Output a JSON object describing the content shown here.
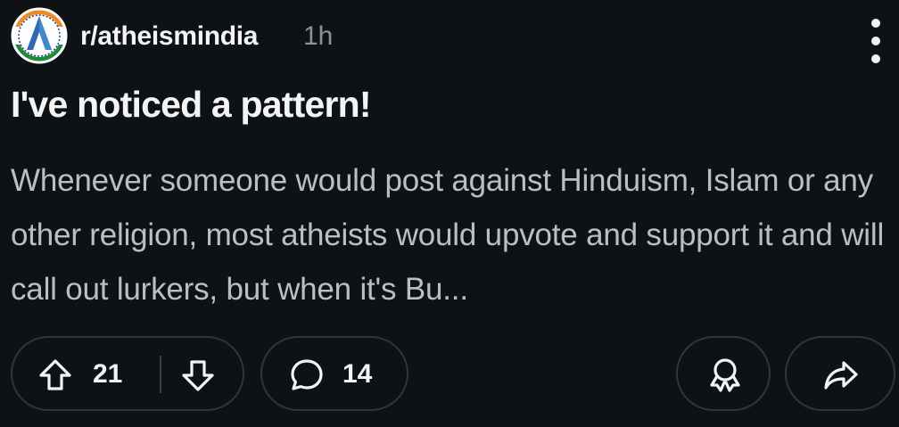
{
  "post": {
    "subreddit": "r/atheismindia",
    "time_ago": "1h",
    "title": "I've noticed a pattern!",
    "body": "Whenever someone would post against Hinduism, Islam or any other religion, most atheists would upvote and support it and will call out lurkers, but when it's Bu..."
  },
  "actions": {
    "vote_count": "21",
    "comment_count": "14"
  },
  "icons": {
    "menu": "vertical-dots-icon",
    "upvote": "arrow-up-icon",
    "downvote": "arrow-down-icon",
    "comment": "speech-bubble-icon",
    "award": "award-icon",
    "share": "share-arrow-icon"
  },
  "colors": {
    "background": "#0f1215",
    "text_primary": "#f2f4f5",
    "text_secondary": "#b8c0c5",
    "muted": "#8a9399",
    "pill_border": "#2f363b"
  }
}
